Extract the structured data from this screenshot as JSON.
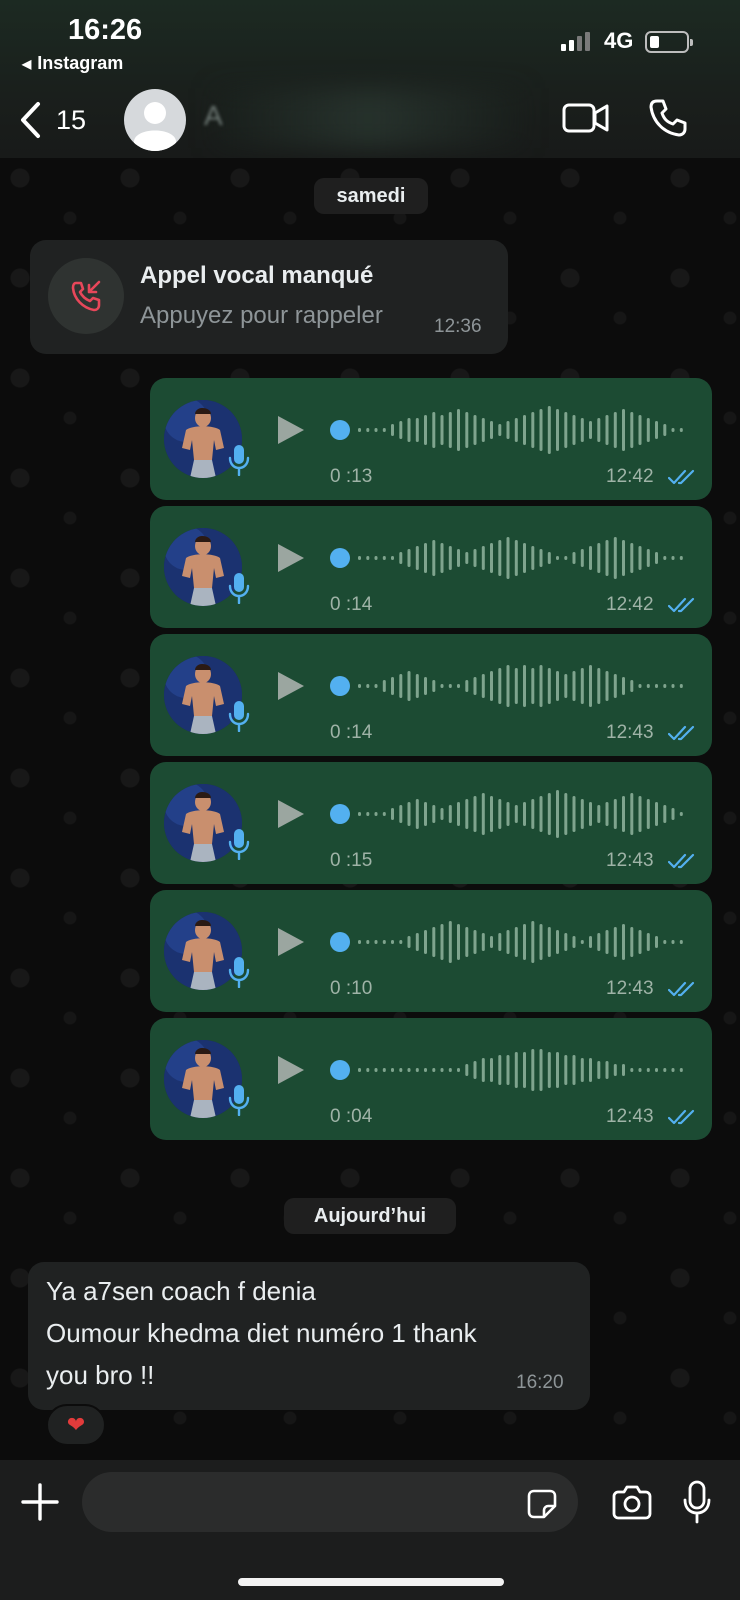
{
  "status_bar": {
    "time": "16:26",
    "back_app": "Instagram",
    "network": "4G"
  },
  "header": {
    "unread_count": "15",
    "contact_name": "A"
  },
  "day_dividers": {
    "first": "samedi",
    "second": "Aujourd’hui"
  },
  "missed_call": {
    "title": "Appel vocal manqué",
    "subtitle": "Appuyez pour rappeler",
    "time": "12:36"
  },
  "voice_notes": [
    {
      "duration": "0 :13",
      "time": "12:42"
    },
    {
      "duration": "0 :14",
      "time": "12:42"
    },
    {
      "duration": "0 :14",
      "time": "12:43"
    },
    {
      "duration": "0 :15",
      "time": "12:43"
    },
    {
      "duration": "0 :10",
      "time": "12:43"
    },
    {
      "duration": "0 :04",
      "time": "12:43"
    }
  ],
  "text_message": {
    "lines": [
      "Ya a7sen coach f denia",
      "Oumour khedma diet numéro 1 thank",
      "you bro !!"
    ],
    "time": "16:20",
    "reaction": "❤"
  },
  "input": {
    "placeholder": ""
  },
  "colors": {
    "outgoing": "#1c4b33",
    "incoming": "#202222",
    "tick_blue": "#53b0f0",
    "missed_red": "#e8475a"
  }
}
